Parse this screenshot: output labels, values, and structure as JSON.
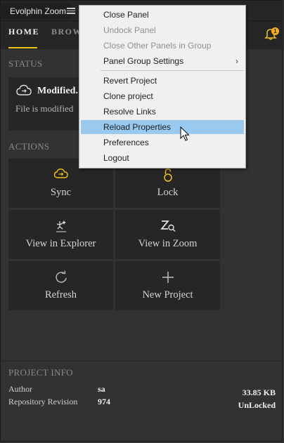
{
  "window": {
    "panel_title": "Evolphin Zoom"
  },
  "nav": {
    "tabs": [
      "HOME",
      "BROW"
    ],
    "notification_count": "1"
  },
  "status": {
    "section_title": "STATUS",
    "title": "Modified.",
    "text": "File is modified"
  },
  "actions": {
    "section_title": "ACTIONS",
    "tiles": [
      "Sync",
      "Lock",
      "View in Explorer",
      "View in Zoom",
      "Refresh",
      "New Project"
    ]
  },
  "project_info": {
    "section_title": "PROJECT INFO",
    "author_label": "Author",
    "author": "sa",
    "revision_label": "Repository Revision",
    "revision": "974",
    "size": "33.85 KB",
    "lock_state": "UnLocked"
  },
  "context_menu": {
    "items": [
      "Close Panel",
      "Undock Panel",
      "Close Other Panels in Group",
      "Panel Group Settings",
      "Revert Project",
      "Clone project",
      "Resolve Links",
      "Reload Properties",
      "Preferences",
      "Logout"
    ]
  },
  "colors": {
    "accent": "#f0c419",
    "panel_bg": "#323232",
    "tile_bg": "#262626",
    "menu_hover": "#99c9ef"
  }
}
